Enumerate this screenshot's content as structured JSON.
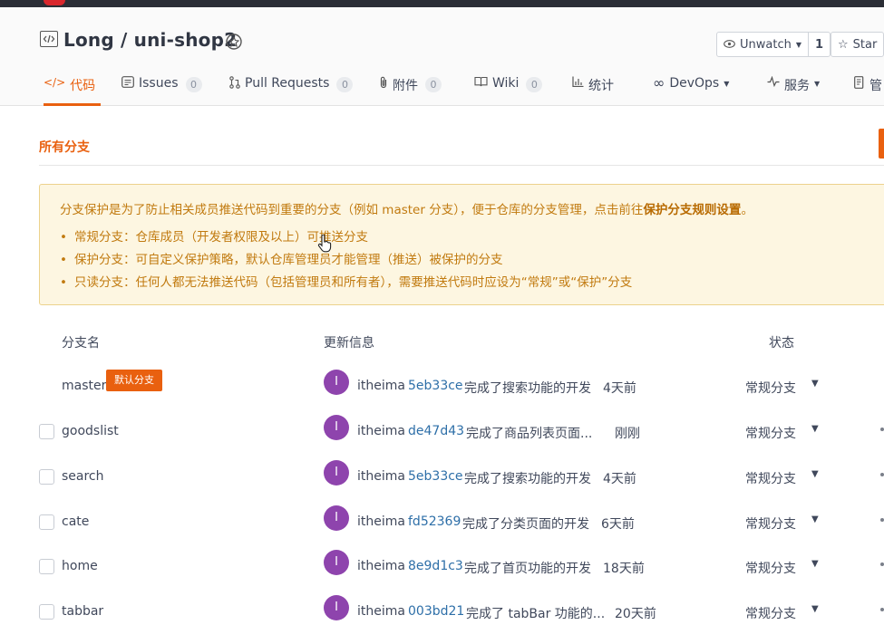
{
  "repo": {
    "title": "Long / uni-shop2"
  },
  "actions": {
    "watch_label": "Unwatch",
    "watch_count": "1",
    "star_label": "Star"
  },
  "tabs": [
    {
      "label": "代码"
    },
    {
      "label": "Issues",
      "count": "0"
    },
    {
      "label": "Pull Requests",
      "count": "0"
    },
    {
      "label": "附件",
      "count": "0"
    },
    {
      "label": "Wiki",
      "count": "0"
    },
    {
      "label": "统计"
    },
    {
      "label": "DevOps"
    },
    {
      "label": "服务"
    },
    {
      "label": "管"
    }
  ],
  "section": {
    "title": "所有分支"
  },
  "notice": {
    "intro": "分支保护是为了防止相关成员推送代码到重要的分支（例如 master 分支），便于仓库的分支管理，点击前往",
    "link": "保护分支规则设置",
    "end": "。",
    "items": [
      "常规分支：仓库成员（开发者权限及以上）可推送分支",
      "保护分支：可自定义保护策略，默认仓库管理员才能管理（推送）被保护的分支",
      "只读分支：任何人都无法推送代码（包括管理员和所有者），需要推送代码时应设为“常规”或“保护”分支"
    ]
  },
  "table": {
    "headers": {
      "name": "分支名",
      "update": "更新信息",
      "status": "状态"
    },
    "rows": [
      {
        "name": "master",
        "badge": "默认分支",
        "avatar": "I",
        "author": "itheima",
        "sha": "5eb33ce",
        "message": "完成了搜索功能的开发",
        "time": "4天前",
        "status": "常规分支"
      },
      {
        "name": "goodslist",
        "avatar": "I",
        "author": "itheima",
        "sha": "de47d43",
        "message": "完成了商品列表页面...",
        "time": "刚刚",
        "status": "常规分支"
      },
      {
        "name": "search",
        "avatar": "I",
        "author": "itheima",
        "sha": "5eb33ce",
        "message": "完成了搜索功能的开发",
        "time": "4天前",
        "status": "常规分支"
      },
      {
        "name": "cate",
        "avatar": "I",
        "author": "itheima",
        "sha": "fd52369",
        "message": "完成了分类页面的开发",
        "time": "6天前",
        "status": "常规分支"
      },
      {
        "name": "home",
        "avatar": "I",
        "author": "itheima",
        "sha": "8e9d1c3",
        "message": "完成了首页功能的开发",
        "time": "18天前",
        "status": "常规分支"
      },
      {
        "name": "tabbar",
        "avatar": "I",
        "author": "itheima",
        "sha": "003bd21",
        "message": "完成了 tabBar 功能的...",
        "time": "20天前",
        "status": "常规分支"
      }
    ]
  },
  "colors": {
    "accent": "#e9600f",
    "sha": "#2e6fa8",
    "avatar": "#8e44ad",
    "notice_bg": "#fdf6e1"
  }
}
